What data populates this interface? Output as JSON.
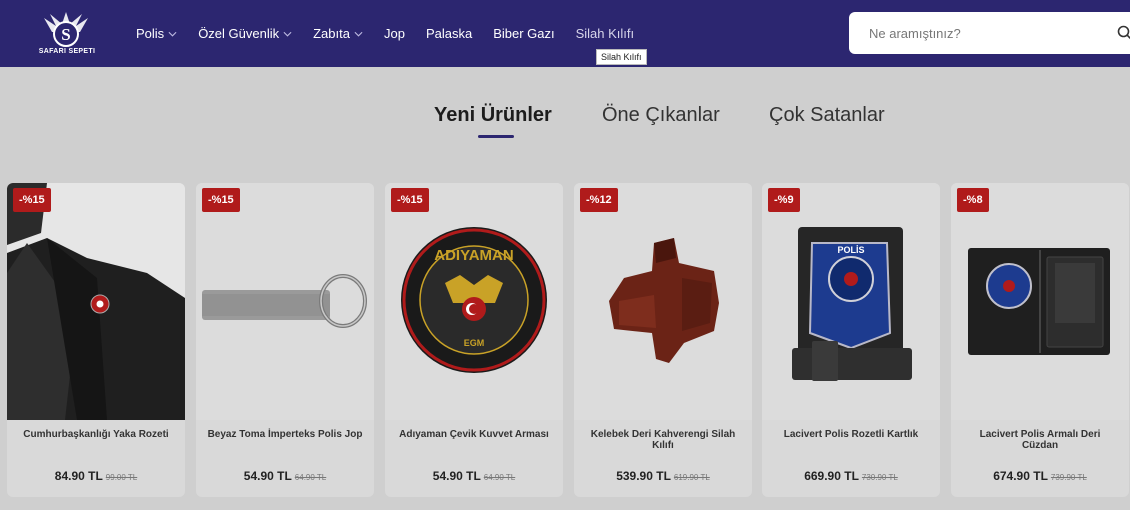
{
  "brand": {
    "name": "SAFARI SEPETI",
    "logo_letter": "S"
  },
  "nav": [
    {
      "label": "Polis",
      "has_dropdown": true
    },
    {
      "label": "Özel Güvenlik",
      "has_dropdown": true
    },
    {
      "label": "Zabıta",
      "has_dropdown": true
    },
    {
      "label": "Jop",
      "has_dropdown": false
    },
    {
      "label": "Palaska",
      "has_dropdown": false
    },
    {
      "label": "Biber Gazı",
      "has_dropdown": false
    },
    {
      "label": "Silah Kılıfı",
      "has_dropdown": false
    }
  ],
  "search": {
    "placeholder": "Ne aramıştınız?",
    "icon": "search-icon"
  },
  "tooltip": "Silah Kılıfı",
  "tabs": [
    {
      "label": "Yeni Ürünler",
      "active": true
    },
    {
      "label": "Öne Çıkanlar",
      "active": false
    },
    {
      "label": "Çok Satanlar",
      "active": false
    }
  ],
  "products": [
    {
      "discount": "-%15",
      "name": "Cumhurbaşkanlığı Yaka Rozeti",
      "price": "84.90 TL",
      "old_price": "99.00 TL"
    },
    {
      "discount": "-%15",
      "name": "Beyaz Toma İmperteks Polis Jop",
      "price": "54.90 TL",
      "old_price": "64.90 TL"
    },
    {
      "discount": "-%15",
      "name": "Adıyaman Çevik Kuvvet Arması",
      "price": "54.90 TL",
      "old_price": "64.90 TL"
    },
    {
      "discount": "-%12",
      "name": "Kelebek Deri Kahverengi Silah Kılıfı",
      "price": "539.90 TL",
      "old_price": "619.90 TL"
    },
    {
      "discount": "-%9",
      "name": "Lacivert Polis Rozetli Kartlık",
      "price": "669.90 TL",
      "old_price": "730.90 TL"
    },
    {
      "discount": "-%8",
      "name": "Lacivert Polis Armalı Deri Cüzdan",
      "price": "674.90 TL",
      "old_price": "739.90 TL"
    }
  ],
  "product_image_text": {
    "patch_top": "ADIYAMAN",
    "patch_bottom": "EGM",
    "badge_word": "POLİS"
  },
  "colors": {
    "header": "#2c2670",
    "badge": "#b01b1b",
    "underline": "#2c2670"
  }
}
